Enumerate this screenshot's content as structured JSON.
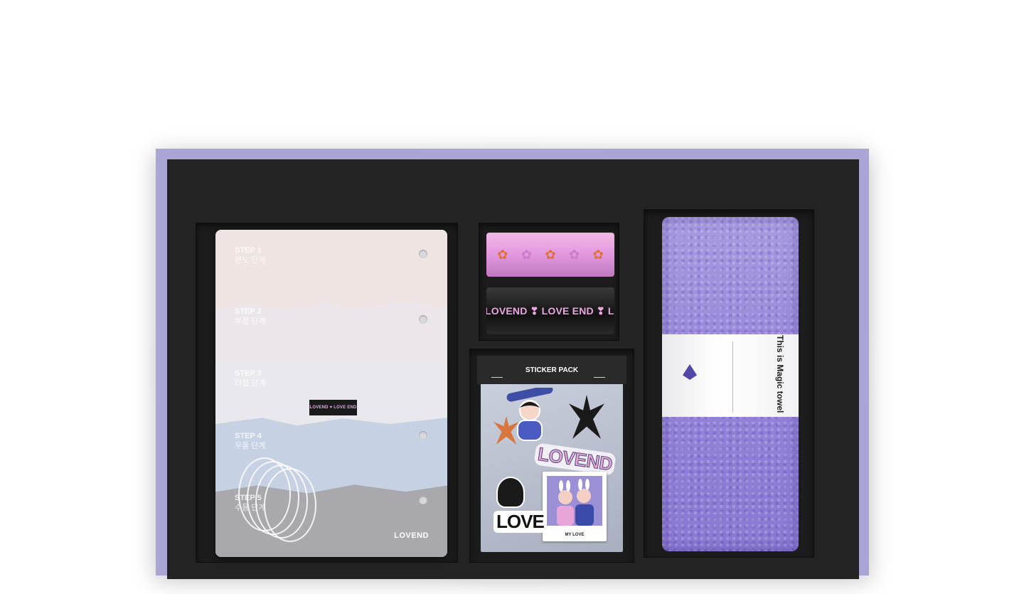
{
  "scene": {
    "kind": "product-gift-box",
    "box_color": "#a9a6d6",
    "tray_color": "#232323"
  },
  "workbook": {
    "steps": [
      {
        "title": "STEP 1",
        "subtitle": "분노 단계"
      },
      {
        "title": "STEP 2",
        "subtitle": "부정 단계"
      },
      {
        "title": "STEP 3",
        "subtitle": "타협 단계"
      },
      {
        "title": "STEP 4",
        "subtitle": "우울 단계"
      },
      {
        "title": "STEP 5",
        "subtitle": "수용 단계"
      }
    ],
    "label": "LOVEND ♥ LOVE END",
    "brand": "LOVEND"
  },
  "tapes": {
    "pink_pattern": [
      "✿",
      "✿",
      "✿",
      "✿",
      "✿"
    ],
    "black_text": "LOVEND ❣ LOVE END ❣ LOVEND"
  },
  "sticker_pack": {
    "title": "STICKER PACK",
    "sticker_big": "LOVEND",
    "sticker_small": "LOVE",
    "polaroid_caption": "MY LOVE"
  },
  "towel": {
    "band_text": "This is Magic towel",
    "color": "#9583d9"
  }
}
